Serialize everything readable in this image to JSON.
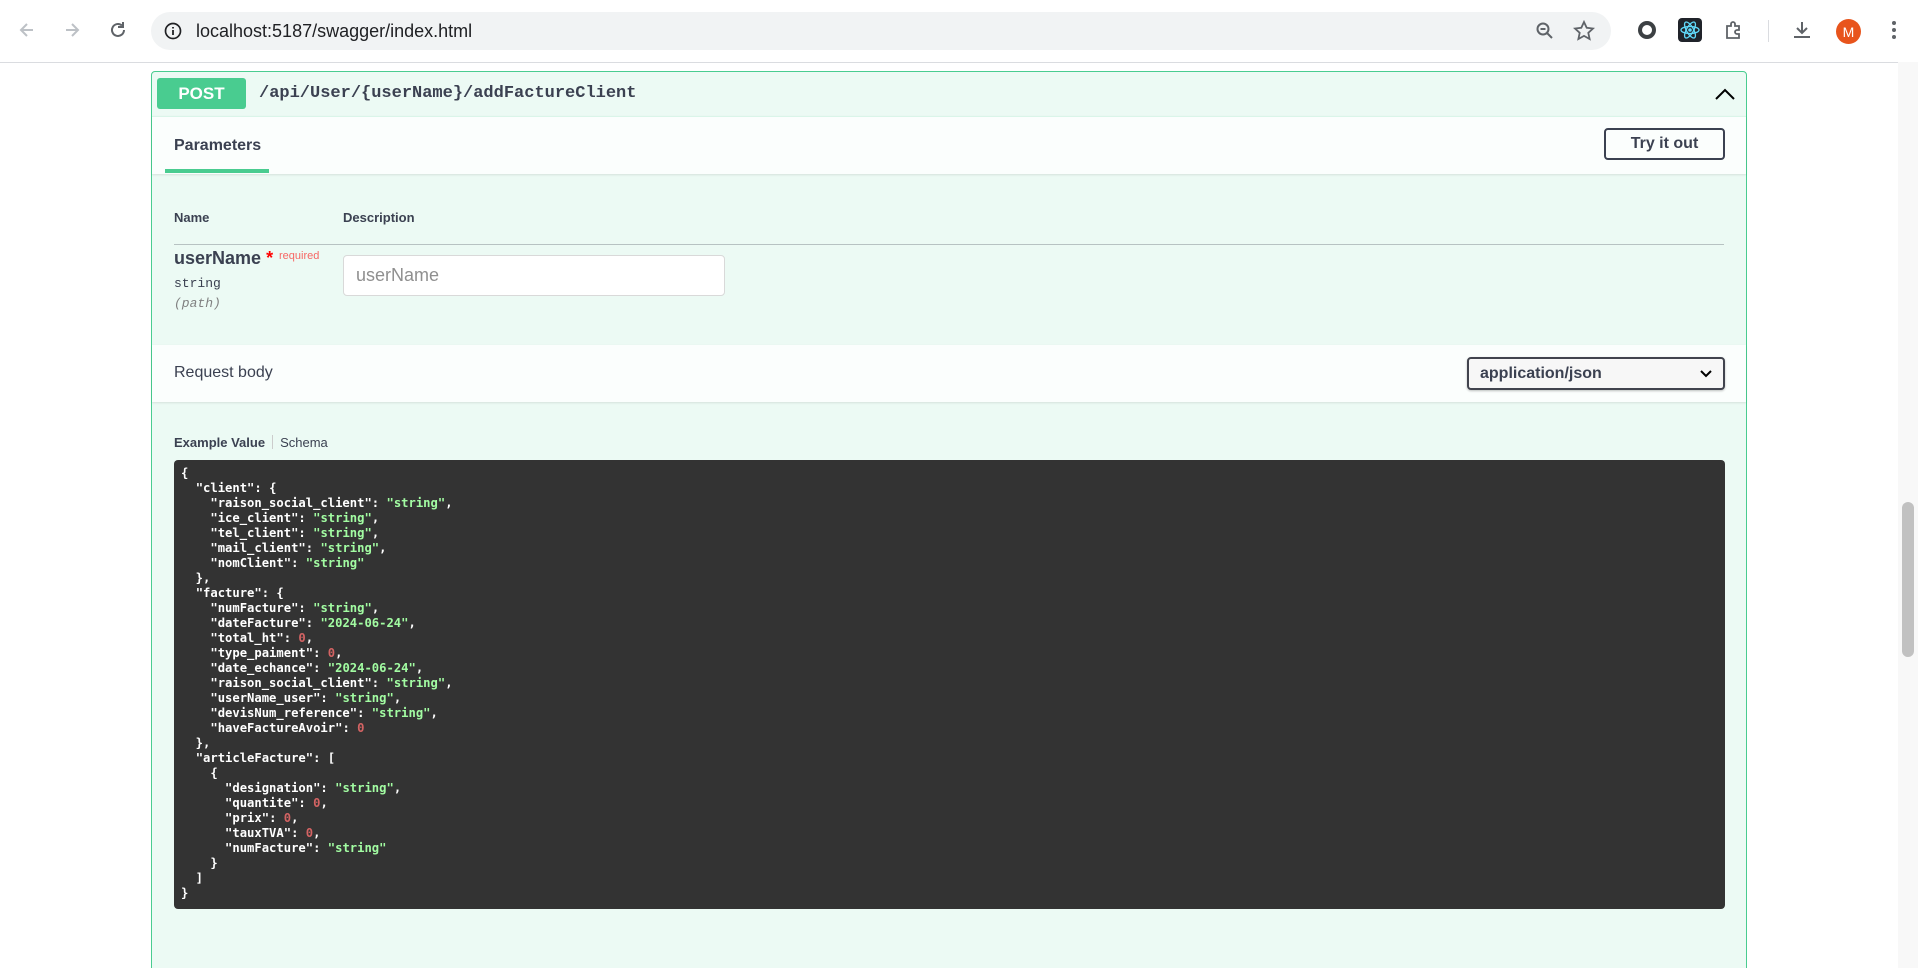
{
  "browser": {
    "url": "localhost:5187/swagger/index.html",
    "avatar_initial": "M"
  },
  "operation": {
    "method": "POST",
    "path": "/api/User/{userName}/addFactureClient",
    "method_color": "#49cc90"
  },
  "parameters": {
    "tab_label": "Parameters",
    "try_button": "Try it out",
    "col_name": "Name",
    "col_description": "Description",
    "param": {
      "name": "userName",
      "required_star": "*",
      "required_label": "required",
      "type": "string",
      "location": "(path)",
      "placeholder": "userName"
    }
  },
  "request_body": {
    "title": "Request body",
    "content_type": "application/json",
    "tab_example": "Example Value",
    "tab_schema": "Schema",
    "example_lines": [
      [
        [
          "p",
          "{"
        ]
      ],
      [
        [
          "p",
          "  "
        ],
        [
          "k",
          "\"client\""
        ],
        [
          "p",
          ": {"
        ]
      ],
      [
        [
          "p",
          "    "
        ],
        [
          "k",
          "\"raison_social_client\""
        ],
        [
          "p",
          ": "
        ],
        [
          "s",
          "\"string\""
        ],
        [
          "p",
          ","
        ]
      ],
      [
        [
          "p",
          "    "
        ],
        [
          "k",
          "\"ice_client\""
        ],
        [
          "p",
          ": "
        ],
        [
          "s",
          "\"string\""
        ],
        [
          "p",
          ","
        ]
      ],
      [
        [
          "p",
          "    "
        ],
        [
          "k",
          "\"tel_client\""
        ],
        [
          "p",
          ": "
        ],
        [
          "s",
          "\"string\""
        ],
        [
          "p",
          ","
        ]
      ],
      [
        [
          "p",
          "    "
        ],
        [
          "k",
          "\"mail_client\""
        ],
        [
          "p",
          ": "
        ],
        [
          "s",
          "\"string\""
        ],
        [
          "p",
          ","
        ]
      ],
      [
        [
          "p",
          "    "
        ],
        [
          "k",
          "\"nomClient\""
        ],
        [
          "p",
          ": "
        ],
        [
          "s",
          "\"string\""
        ]
      ],
      [
        [
          "p",
          "  },"
        ]
      ],
      [
        [
          "p",
          "  "
        ],
        [
          "k",
          "\"facture\""
        ],
        [
          "p",
          ": {"
        ]
      ],
      [
        [
          "p",
          "    "
        ],
        [
          "k",
          "\"numFacture\""
        ],
        [
          "p",
          ": "
        ],
        [
          "s",
          "\"string\""
        ],
        [
          "p",
          ","
        ]
      ],
      [
        [
          "p",
          "    "
        ],
        [
          "k",
          "\"dateFacture\""
        ],
        [
          "p",
          ": "
        ],
        [
          "s",
          "\"2024-06-24\""
        ],
        [
          "p",
          ","
        ]
      ],
      [
        [
          "p",
          "    "
        ],
        [
          "k",
          "\"total_ht\""
        ],
        [
          "p",
          ": "
        ],
        [
          "n",
          "0"
        ],
        [
          "p",
          ","
        ]
      ],
      [
        [
          "p",
          "    "
        ],
        [
          "k",
          "\"type_paiment\""
        ],
        [
          "p",
          ": "
        ],
        [
          "n",
          "0"
        ],
        [
          "p",
          ","
        ]
      ],
      [
        [
          "p",
          "    "
        ],
        [
          "k",
          "\"date_echance\""
        ],
        [
          "p",
          ": "
        ],
        [
          "s",
          "\"2024-06-24\""
        ],
        [
          "p",
          ","
        ]
      ],
      [
        [
          "p",
          "    "
        ],
        [
          "k",
          "\"raison_social_client\""
        ],
        [
          "p",
          ": "
        ],
        [
          "s",
          "\"string\""
        ],
        [
          "p",
          ","
        ]
      ],
      [
        [
          "p",
          "    "
        ],
        [
          "k",
          "\"userName_user\""
        ],
        [
          "p",
          ": "
        ],
        [
          "s",
          "\"string\""
        ],
        [
          "p",
          ","
        ]
      ],
      [
        [
          "p",
          "    "
        ],
        [
          "k",
          "\"devisNum_reference\""
        ],
        [
          "p",
          ": "
        ],
        [
          "s",
          "\"string\""
        ],
        [
          "p",
          ","
        ]
      ],
      [
        [
          "p",
          "    "
        ],
        [
          "k",
          "\"haveFactureAvoir\""
        ],
        [
          "p",
          ": "
        ],
        [
          "n",
          "0"
        ]
      ],
      [
        [
          "p",
          "  },"
        ]
      ],
      [
        [
          "p",
          "  "
        ],
        [
          "k",
          "\"articleFacture\""
        ],
        [
          "p",
          ": ["
        ]
      ],
      [
        [
          "p",
          "    {"
        ]
      ],
      [
        [
          "p",
          "      "
        ],
        [
          "k",
          "\"designation\""
        ],
        [
          "p",
          ": "
        ],
        [
          "s",
          "\"string\""
        ],
        [
          "p",
          ","
        ]
      ],
      [
        [
          "p",
          "      "
        ],
        [
          "k",
          "\"quantite\""
        ],
        [
          "p",
          ": "
        ],
        [
          "n",
          "0"
        ],
        [
          "p",
          ","
        ]
      ],
      [
        [
          "p",
          "      "
        ],
        [
          "k",
          "\"prix\""
        ],
        [
          "p",
          ": "
        ],
        [
          "n",
          "0"
        ],
        [
          "p",
          ","
        ]
      ],
      [
        [
          "p",
          "      "
        ],
        [
          "k",
          "\"tauxTVA\""
        ],
        [
          "p",
          ": "
        ],
        [
          "n",
          "0"
        ],
        [
          "p",
          ","
        ]
      ],
      [
        [
          "p",
          "      "
        ],
        [
          "k",
          "\"numFacture\""
        ],
        [
          "p",
          ": "
        ],
        [
          "s",
          "\"string\""
        ]
      ],
      [
        [
          "p",
          "    }"
        ]
      ],
      [
        [
          "p",
          "  ]"
        ]
      ],
      [
        [
          "p",
          "}"
        ]
      ]
    ]
  }
}
